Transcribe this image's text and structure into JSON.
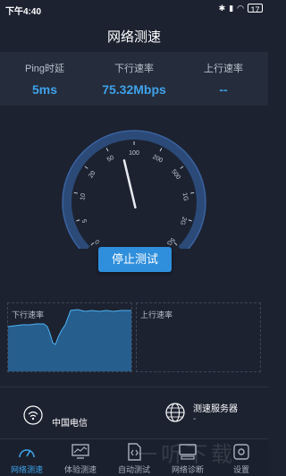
{
  "status_bar": {
    "time": "下午4:40",
    "icons": [
      "bluetooth-icon",
      "signal-icon",
      "wifi-icon"
    ],
    "battery": "17"
  },
  "title": "网络测速",
  "stats": {
    "ping": {
      "label": "Ping时延",
      "value": "5ms"
    },
    "download": {
      "label": "下行速率",
      "value": "75.32Mbps"
    },
    "upload": {
      "label": "上行速率",
      "value": "--"
    }
  },
  "gauge": {
    "ticks": [
      "0",
      "5",
      "10",
      "20",
      "50",
      "100",
      "200",
      "500",
      "1G",
      "2G",
      "5G"
    ],
    "needle_value": "75.32"
  },
  "stop_button": "停止测试",
  "graphs": {
    "download_label": "下行速率",
    "upload_label": "上行速率"
  },
  "network": {
    "carrier": "中国电信",
    "server_label": "测速服务器",
    "server_value": "-"
  },
  "tabs": [
    {
      "label": "网络测速",
      "icon": "speedometer-icon",
      "active": true
    },
    {
      "label": "体验测速",
      "icon": "monitor-chart-icon",
      "active": false
    },
    {
      "label": "自动测试",
      "icon": "code-file-icon",
      "active": false
    },
    {
      "label": "网络诊断",
      "icon": "computer-icon",
      "active": false
    },
    {
      "label": "设置",
      "icon": "gear-icon",
      "active": false
    }
  ],
  "watermark": "一听下载",
  "colors": {
    "accent": "#3fa2ea",
    "background": "#1c2230",
    "panel": "#252c3b"
  }
}
